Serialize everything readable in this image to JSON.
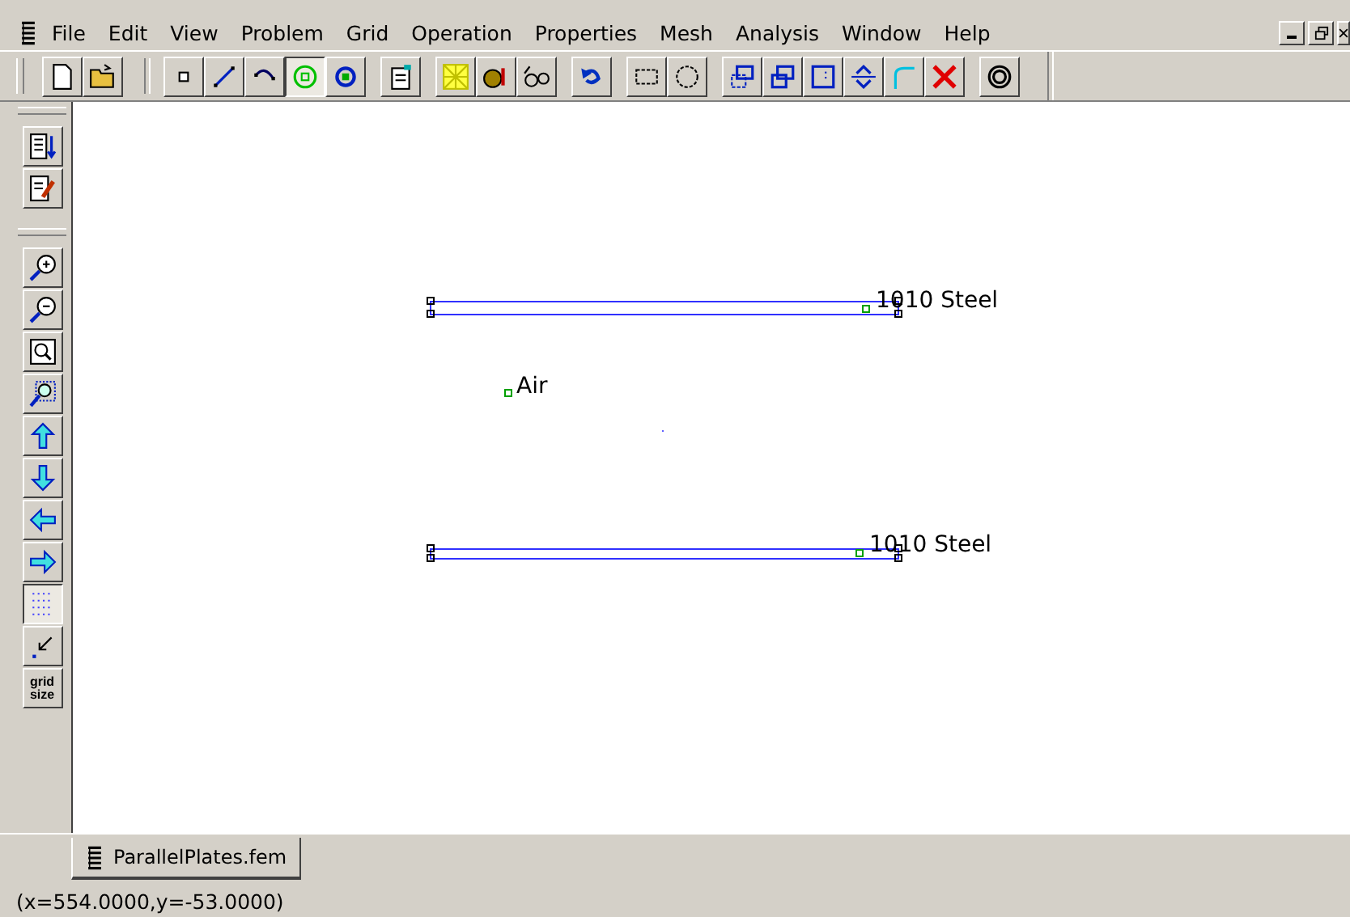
{
  "menu": [
    "File",
    "Edit",
    "View",
    "Problem",
    "Grid",
    "Operation",
    "Properties",
    "Mesh",
    "Analysis",
    "Window",
    "Help"
  ],
  "toolbar": {
    "groups": [
      [
        {
          "kind": "new",
          "selected": false
        },
        {
          "kind": "open",
          "selected": false
        }
      ],
      [
        {
          "kind": "node",
          "selected": false
        },
        {
          "kind": "segment",
          "selected": false
        },
        {
          "kind": "arc",
          "selected": false
        },
        {
          "kind": "block",
          "selected": true
        },
        {
          "kind": "group",
          "selected": false
        }
      ],
      [
        {
          "kind": "properties",
          "selected": false
        }
      ],
      [
        {
          "kind": "mesh",
          "selected": false
        },
        {
          "kind": "run",
          "selected": false
        },
        {
          "kind": "view",
          "selected": false
        }
      ],
      [
        {
          "kind": "undo",
          "selected": false
        }
      ],
      [
        {
          "kind": "select-rect",
          "selected": false
        },
        {
          "kind": "select-circle",
          "selected": false
        }
      ],
      [
        {
          "kind": "copy",
          "selected": false
        },
        {
          "kind": "move",
          "selected": false
        },
        {
          "kind": "scale",
          "selected": false
        },
        {
          "kind": "mirror",
          "selected": false
        },
        {
          "kind": "fillet",
          "selected": false
        },
        {
          "kind": "delete",
          "selected": false
        }
      ],
      [
        {
          "kind": "outline",
          "selected": false
        }
      ]
    ]
  },
  "side_toolbar": {
    "groups": [
      [
        {
          "kind": "list",
          "selected": false
        },
        {
          "kind": "edit",
          "selected": false
        }
      ],
      [
        {
          "kind": "zoom-in",
          "selected": false
        },
        {
          "kind": "zoom-out",
          "selected": false
        },
        {
          "kind": "zoom-page",
          "selected": false
        },
        {
          "kind": "zoom-window",
          "selected": false
        },
        {
          "kind": "up",
          "selected": false
        },
        {
          "kind": "down",
          "selected": false
        },
        {
          "kind": "left",
          "selected": false
        },
        {
          "kind": "right",
          "selected": false
        },
        {
          "kind": "grid",
          "selected": true
        },
        {
          "kind": "snap",
          "selected": false
        },
        {
          "kind": "grid-size",
          "label": "grid size",
          "selected": false
        }
      ]
    ]
  },
  "canvas": {
    "labels": [
      {
        "text": "1010 Steel"
      },
      {
        "text": "Air"
      },
      {
        "text": "1010 Steel"
      }
    ]
  },
  "tabs": [
    {
      "label": "ParallelPlates.fem",
      "selected": true
    }
  ],
  "status_bar": "(x=554.0000,y=-53.0000)"
}
